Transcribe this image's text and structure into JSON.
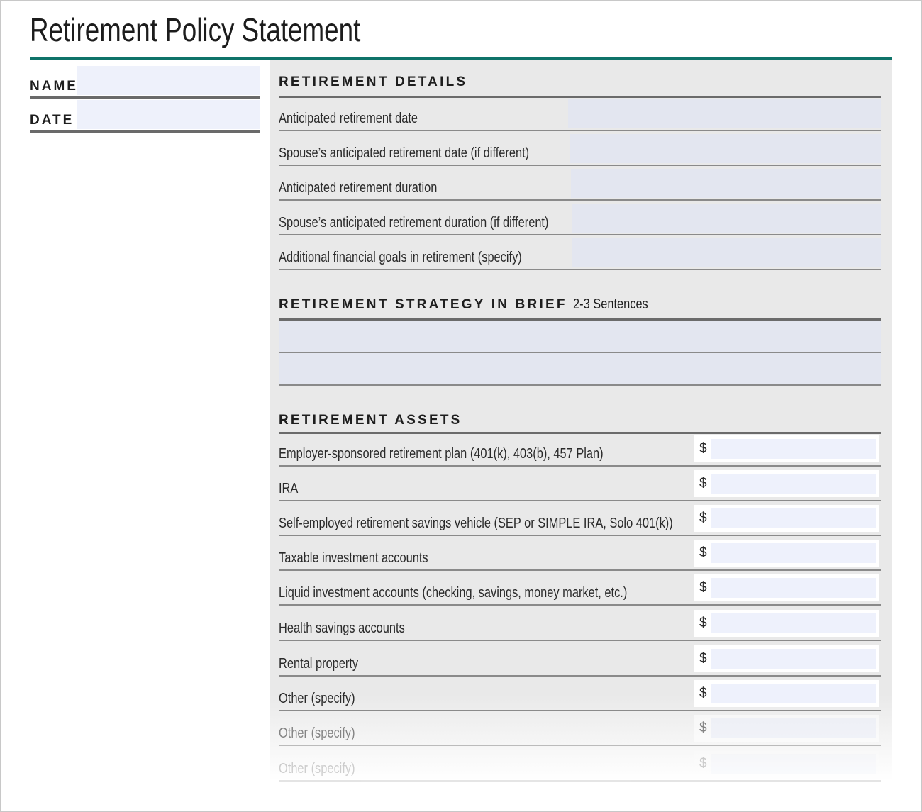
{
  "document": {
    "title": "Retirement Policy Statement",
    "accent_color": "#0f7369"
  },
  "meta": {
    "name_label": "NAME",
    "name_value": "",
    "date_label": "DATE",
    "date_value": ""
  },
  "retirement_details": {
    "heading": "RETIREMENT DETAILS",
    "rows": [
      {
        "label": "Anticipated retirement date",
        "value": ""
      },
      {
        "label": "Spouse’s anticipated retirement date (if different)",
        "value": ""
      },
      {
        "label": "Anticipated retirement duration",
        "value": ""
      },
      {
        "label": "Spouse’s anticipated retirement duration (if different)",
        "value": ""
      },
      {
        "label": "Additional financial goals in retirement (specify)",
        "value": ""
      }
    ]
  },
  "retirement_strategy": {
    "heading": "RETIREMENT STRATEGY IN BRIEF",
    "subheading": "2-3 Sentences",
    "lines": [
      "",
      ""
    ]
  },
  "retirement_assets": {
    "heading": "RETIREMENT ASSETS",
    "currency_symbol": "$",
    "rows": [
      {
        "label": "Employer-sponsored retirement plan (401(k), 403(b), 457 Plan)",
        "value": ""
      },
      {
        "label": "IRA",
        "value": ""
      },
      {
        "label": "Self-employed retirement savings vehicle (SEP or SIMPLE IRA, Solo 401(k))",
        "value": ""
      },
      {
        "label": "Taxable investment accounts",
        "value": ""
      },
      {
        "label": "Liquid investment accounts (checking, savings, money market, etc.)",
        "value": ""
      },
      {
        "label": "Health savings accounts",
        "value": ""
      },
      {
        "label": "Rental property",
        "value": ""
      },
      {
        "label": "Other (specify)",
        "value": ""
      },
      {
        "label": "Other (specify)",
        "value": ""
      },
      {
        "label": "Other (specify)",
        "value": ""
      }
    ]
  }
}
